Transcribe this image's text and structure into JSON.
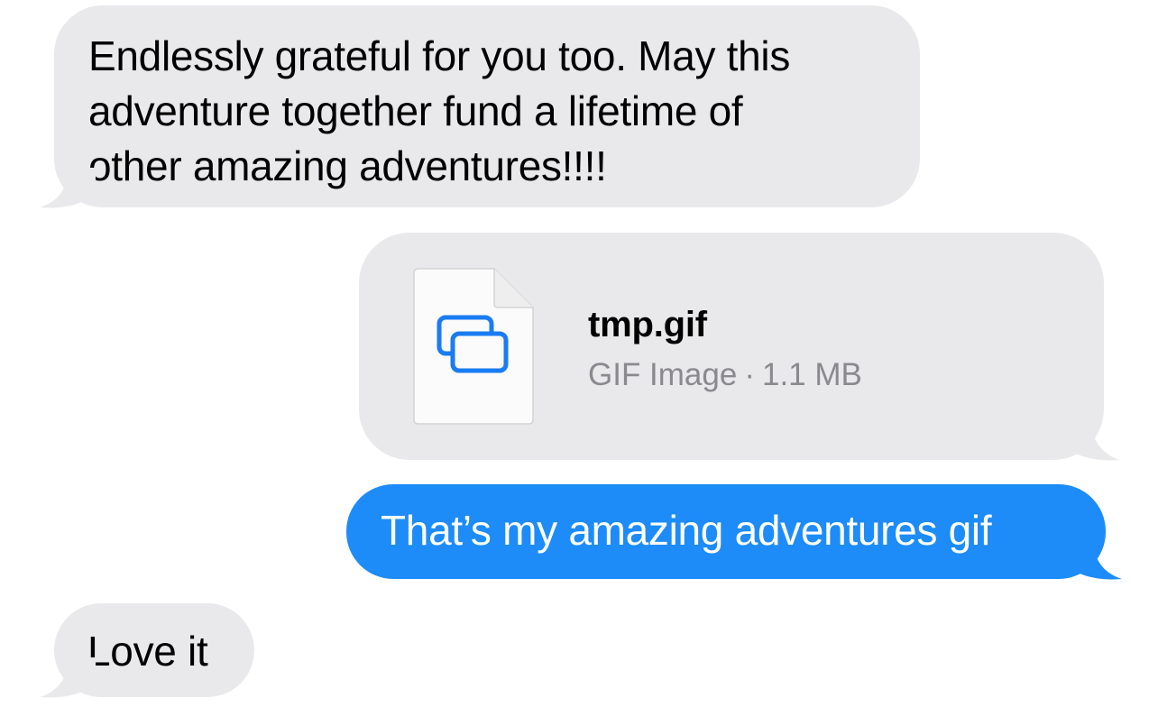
{
  "conversation": {
    "messages": [
      {
        "direction": "incoming",
        "text": "Endlessly grateful for you too. May this\nadventure together fund a lifetime of\nother amazing adventures!!!!"
      },
      {
        "direction": "outgoing",
        "attachment": {
          "file_name": "tmp.gif",
          "file_type": "GIF Image",
          "separator": "·",
          "file_size": "1.1 MB",
          "icon": "gif-file-icon"
        }
      },
      {
        "direction": "outgoing",
        "text": "That’s my amazing adventures gif"
      },
      {
        "direction": "incoming",
        "text": "Love it"
      }
    ]
  },
  "colors": {
    "incoming_bubble": "#e9e9eb",
    "outgoing_bubble": "#1d8cf8",
    "file_icon_accent": "#1a7cf2",
    "meta_text": "#8a8a8e"
  }
}
